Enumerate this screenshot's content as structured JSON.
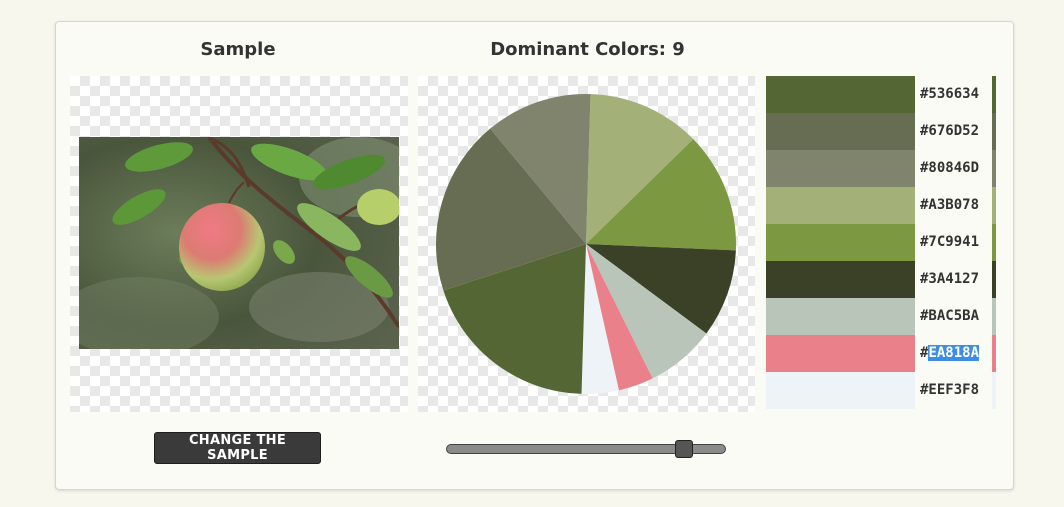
{
  "sample": {
    "title": "Sample",
    "photo_alt": "apple on branch"
  },
  "dominant": {
    "title_prefix": "Dominant Colors:",
    "count": "9"
  },
  "colors": [
    {
      "hex": "#536634",
      "label": "#536634"
    },
    {
      "hex": "#676D52",
      "label": "#676D52"
    },
    {
      "hex": "#80846D",
      "label": "#80846D"
    },
    {
      "hex": "#A3B078",
      "label": "#A3B078"
    },
    {
      "hex": "#7C9941",
      "label": "#7C9941"
    },
    {
      "hex": "#3A4127",
      "label": "#3A4127"
    },
    {
      "hex": "#BAC5BA",
      "label": "#BAC5BA"
    },
    {
      "hex": "#EA818A",
      "label_prefix": "#",
      "label_selected": "EA818A"
    },
    {
      "hex": "#EEF3F8",
      "label": "#EEF3F8"
    }
  ],
  "pie_shares": [
    {
      "hex": "#A3B078",
      "fraction": 0.122
    },
    {
      "hex": "#7C9941",
      "fraction": 0.13
    },
    {
      "hex": "#3A4127",
      "fraction": 0.095
    },
    {
      "hex": "#BAC5BA",
      "fraction": 0.075
    },
    {
      "hex": "#EA818A",
      "fraction": 0.038
    },
    {
      "hex": "#EEF3F8",
      "fraction": 0.04
    },
    {
      "hex": "#536634",
      "fraction": 0.195
    },
    {
      "hex": "#676D52",
      "fraction": 0.19
    },
    {
      "hex": "#80846D",
      "fraction": 0.115
    }
  ],
  "controls": {
    "change_button_label": "CHANGE THE SAMPLE",
    "slider_value_fraction": 0.87
  }
}
